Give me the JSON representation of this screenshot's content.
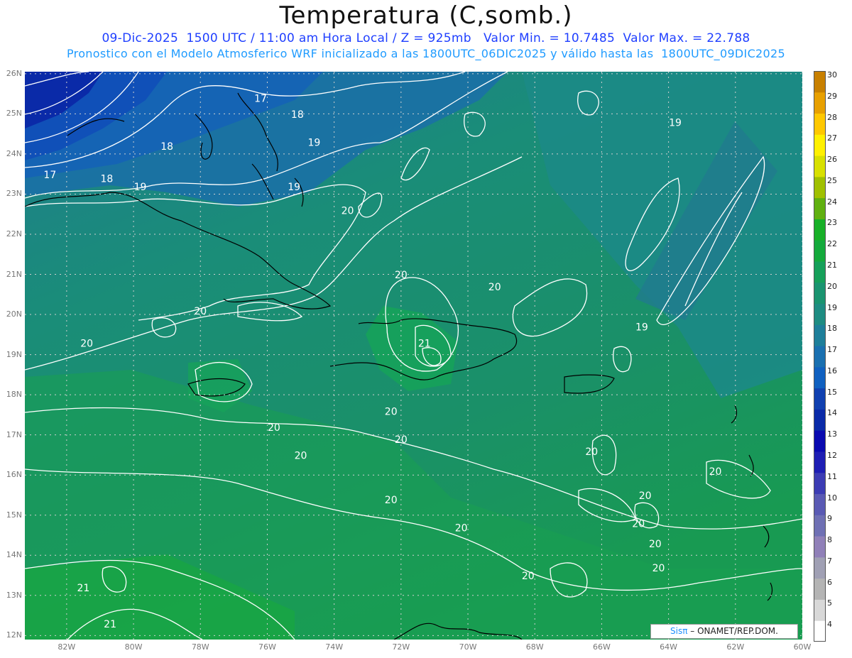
{
  "header": {
    "title": "Temperatura (C,somb.)",
    "line1": "09-Dic-2025  1500 UTC / 11:00 am Hora Local / Z = 925mb   Valor Min. = 10.7485  Valor Max. = 22.788",
    "line2": "Pronostico con el Modelo Atmosferico WRF inicializado a las 1800UTC_06DIC2025 y válido hasta las  1800UTC_09DIC2025"
  },
  "map": {
    "lat_labels": [
      "26N",
      "25N",
      "24N",
      "23N",
      "22N",
      "21N",
      "20N",
      "19N",
      "18N",
      "17N",
      "16N",
      "15N",
      "14N",
      "13N",
      "12N"
    ],
    "lon_labels": [
      "82W",
      "80W",
      "78W",
      "76W",
      "74W",
      "72W",
      "70W",
      "68W",
      "66W",
      "64W",
      "62W",
      "60W"
    ],
    "contour_labels": [
      {
        "text": "17",
        "lon": -76.2,
        "lat": 25.3
      },
      {
        "text": "18",
        "lon": -75.1,
        "lat": 24.9
      },
      {
        "text": "18",
        "lon": -79.0,
        "lat": 24.1
      },
      {
        "text": "19",
        "lon": -74.6,
        "lat": 24.2
      },
      {
        "text": "17",
        "lon": -82.5,
        "lat": 23.4
      },
      {
        "text": "18",
        "lon": -80.8,
        "lat": 23.3
      },
      {
        "text": "19",
        "lon": -79.8,
        "lat": 23.1
      },
      {
        "text": "19",
        "lon": -75.2,
        "lat": 23.1
      },
      {
        "text": "19",
        "lon": -63.8,
        "lat": 24.7
      },
      {
        "text": "20",
        "lon": -73.6,
        "lat": 22.5
      },
      {
        "text": "20",
        "lon": -72.0,
        "lat": 20.9
      },
      {
        "text": "20",
        "lon": -69.2,
        "lat": 20.6
      },
      {
        "text": "20",
        "lon": -78.0,
        "lat": 20.0
      },
      {
        "text": "19",
        "lon": -64.8,
        "lat": 19.6
      },
      {
        "text": "20",
        "lon": -81.4,
        "lat": 19.2
      },
      {
        "text": "21",
        "lon": -71.3,
        "lat": 19.2
      },
      {
        "text": "20",
        "lon": -72.3,
        "lat": 17.5
      },
      {
        "text": "20",
        "lon": -75.8,
        "lat": 17.1
      },
      {
        "text": "20",
        "lon": -72.0,
        "lat": 16.8
      },
      {
        "text": "20",
        "lon": -66.3,
        "lat": 16.5
      },
      {
        "text": "20",
        "lon": -75.0,
        "lat": 16.4
      },
      {
        "text": "20",
        "lon": -62.6,
        "lat": 16.0
      },
      {
        "text": "20",
        "lon": -72.3,
        "lat": 15.3
      },
      {
        "text": "20",
        "lon": -64.7,
        "lat": 15.4
      },
      {
        "text": "20",
        "lon": -70.2,
        "lat": 14.6
      },
      {
        "text": "20",
        "lon": -64.9,
        "lat": 14.7
      },
      {
        "text": "20",
        "lon": -64.4,
        "lat": 14.2
      },
      {
        "text": "20",
        "lon": -64.3,
        "lat": 13.6
      },
      {
        "text": "20",
        "lon": -68.2,
        "lat": 13.4
      },
      {
        "text": "21",
        "lon": -81.5,
        "lat": 13.1
      },
      {
        "text": "21",
        "lon": -80.7,
        "lat": 12.2
      }
    ]
  },
  "colorbar": {
    "labels": [
      "4",
      "5",
      "6",
      "7",
      "8",
      "9",
      "10",
      "11",
      "12",
      "13",
      "14",
      "15",
      "16",
      "17",
      "18",
      "19",
      "20",
      "21",
      "22",
      "23",
      "24",
      "25",
      "26",
      "27",
      "28",
      "29",
      "30"
    ],
    "colors": [
      "#ffffff",
      "#d8d8d8",
      "#b4b4b4",
      "#a0a0b4",
      "#9080b8",
      "#6f70b4",
      "#5a5ab4",
      "#3c3cb4",
      "#1e1eb4",
      "#0a0ab0",
      "#0a2aa8",
      "#1040b0",
      "#1060c0",
      "#1a70b0",
      "#1e7f9a",
      "#1e8c82",
      "#1a9470",
      "#16a05a",
      "#14aa3c",
      "#18b028",
      "#60b010",
      "#a0c000",
      "#d8e000",
      "#fff000",
      "#ffc800",
      "#e8a000",
      "#c88000"
    ]
  },
  "credit": {
    "sis": "Sisπ",
    "rest": "– ONAMET/REP.DOM."
  }
}
